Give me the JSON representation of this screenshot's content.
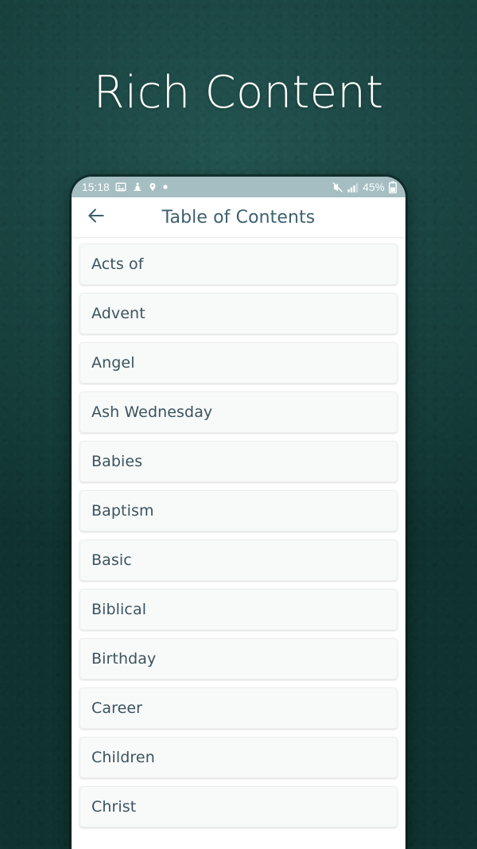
{
  "promo": {
    "title": "Rich Content",
    "background_color": "#18423f",
    "title_color": "#ffffff"
  },
  "phone": {
    "status_bar": {
      "background_color": "#a5bec2",
      "time": "15:18",
      "left_icons": [
        "photo-icon",
        "figure-icon",
        "location-pin-icon",
        "dot-icon"
      ],
      "right_icons": [
        "mute-icon",
        "signal-bars-icon",
        "battery-icon"
      ],
      "battery_percent": "45%"
    },
    "app_bar": {
      "back_icon": "back-arrow-icon",
      "title": "Table of Contents",
      "title_color": "#3d6070",
      "background_color": "#ffffff"
    },
    "toc": {
      "item_background": "#f8f9f9",
      "item_text_color": "#3a5460",
      "items": [
        {
          "label": "Acts of"
        },
        {
          "label": "Advent"
        },
        {
          "label": "Angel"
        },
        {
          "label": "Ash Wednesday"
        },
        {
          "label": "Babies"
        },
        {
          "label": "Baptism"
        },
        {
          "label": "Basic"
        },
        {
          "label": "Biblical"
        },
        {
          "label": "Birthday"
        },
        {
          "label": "Career"
        },
        {
          "label": "Children"
        },
        {
          "label": "Christ"
        }
      ]
    }
  }
}
